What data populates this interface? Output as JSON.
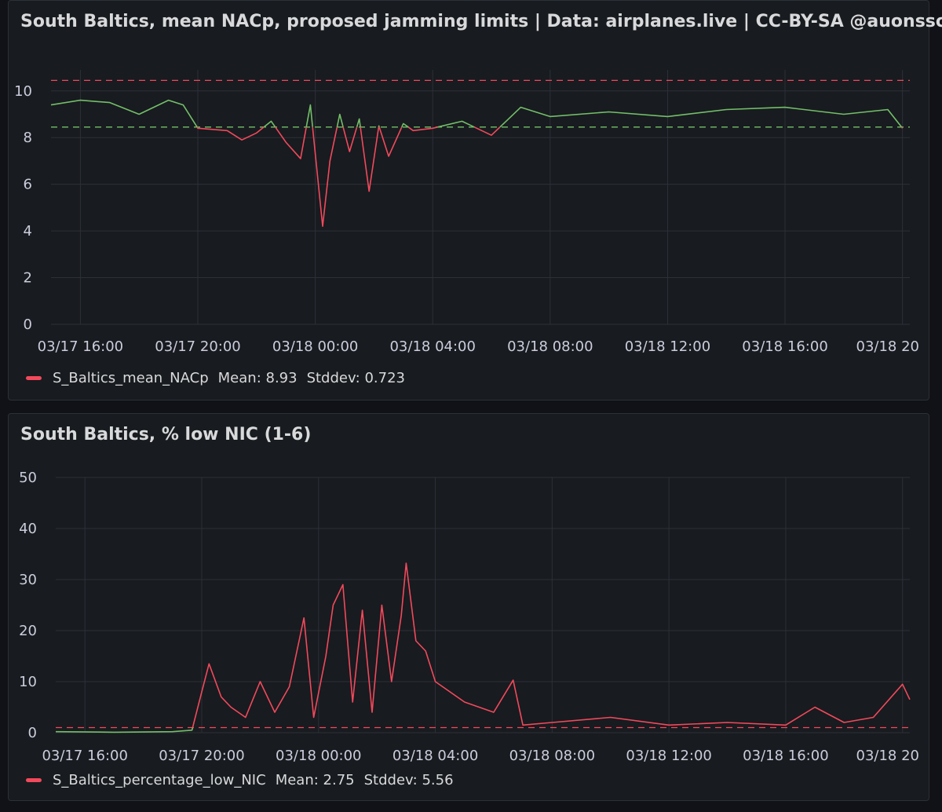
{
  "colors": {
    "ok": "#73bf69",
    "bad": "#f2495c",
    "grid": "#2c3038",
    "panel_bg": "#181b1f",
    "page_bg": "#111217"
  },
  "panels": [
    {
      "title": "South Baltics, mean NACp, proposed jamming limits | Data: airplanes.live | CC-BY-SA @auonsson",
      "legend": {
        "name": "S_Baltics_mean_NACp",
        "mean": "Mean: 8.93",
        "stddev": "Stddev: 0.723"
      }
    },
    {
      "title": "South Baltics, % low NIC (1-6)",
      "legend": {
        "name": "S_Baltics_percentage_low_NIC",
        "mean": "Mean: 2.75",
        "stddev": "Stddev: 5.56"
      }
    }
  ],
  "chart_data": [
    {
      "type": "line",
      "title": "South Baltics, mean NACp, proposed jamming limits | Data: airplanes.live | CC-BY-SA @auonsson",
      "xlabel": "",
      "ylabel": "",
      "xlim": [
        "03/17 15:00",
        "03/18 20:15"
      ],
      "ylim": [
        0,
        10.9
      ],
      "y_ticks": [
        0,
        2,
        4,
        6,
        8,
        10
      ],
      "x_ticks": [
        "03/17 16:00",
        "03/17 20:00",
        "03/18 00:00",
        "03/18 04:00",
        "03/18 08:00",
        "03/18 12:00",
        "03/18 16:00",
        "03/18 20"
      ],
      "grid": true,
      "legend_position": "bottom-left",
      "thresholds": [
        {
          "value": 10.45,
          "color": "#f2495c",
          "style": "dashed"
        },
        {
          "value": 8.45,
          "color": "#73bf69",
          "style": "dashed"
        }
      ],
      "color_rule": "line is green at or above 8.45 and red below",
      "series": [
        {
          "name": "S_Baltics_mean_NACp",
          "points": [
            [
              "03/17 15:00",
              9.4
            ],
            [
              "03/17 16:00",
              9.6
            ],
            [
              "03/17 17:00",
              9.5
            ],
            [
              "03/17 18:00",
              9.0
            ],
            [
              "03/17 19:00",
              9.6
            ],
            [
              "03/17 19:30",
              9.4
            ],
            [
              "03/17 20:00",
              8.4
            ],
            [
              "03/17 21:00",
              8.3
            ],
            [
              "03/17 21:30",
              7.9
            ],
            [
              "03/17 22:00",
              8.2
            ],
            [
              "03/17 22:30",
              8.7
            ],
            [
              "03/17 23:00",
              7.8
            ],
            [
              "03/17 23:30",
              7.1
            ],
            [
              "03/17 23:50",
              9.4
            ],
            [
              "03/18 00:15",
              4.2
            ],
            [
              "03/18 00:30",
              7.0
            ],
            [
              "03/18 00:50",
              9.0
            ],
            [
              "03/18 01:10",
              7.4
            ],
            [
              "03/18 01:30",
              8.8
            ],
            [
              "03/18 01:50",
              5.7
            ],
            [
              "03/18 02:10",
              8.5
            ],
            [
              "03/18 02:30",
              7.2
            ],
            [
              "03/18 03:00",
              8.6
            ],
            [
              "03/18 03:20",
              8.3
            ],
            [
              "03/18 04:00",
              8.4
            ],
            [
              "03/18 05:00",
              8.7
            ],
            [
              "03/18 06:00",
              8.1
            ],
            [
              "03/18 06:30",
              8.7
            ],
            [
              "03/18 07:00",
              9.3
            ],
            [
              "03/18 08:00",
              8.9
            ],
            [
              "03/18 10:00",
              9.1
            ],
            [
              "03/18 12:00",
              8.9
            ],
            [
              "03/18 14:00",
              9.2
            ],
            [
              "03/18 16:00",
              9.3
            ],
            [
              "03/18 18:00",
              9.0
            ],
            [
              "03/18 19:30",
              9.2
            ],
            [
              "03/18 20:00",
              8.4
            ]
          ]
        }
      ]
    },
    {
      "type": "line",
      "title": "South Baltics, % low NIC (1-6)",
      "xlabel": "",
      "ylabel": "",
      "xlim": [
        "03/17 15:00",
        "03/18 20:15"
      ],
      "ylim": [
        0,
        50
      ],
      "y_ticks": [
        0,
        10,
        20,
        30,
        40,
        50
      ],
      "x_ticks": [
        "03/17 16:00",
        "03/17 20:00",
        "03/18 00:00",
        "03/18 04:00",
        "03/18 08:00",
        "03/18 12:00",
        "03/18 16:00",
        "03/18 20"
      ],
      "grid": true,
      "legend_position": "bottom-left",
      "thresholds": [
        {
          "value": 1,
          "color": "#f2495c",
          "style": "dashed"
        }
      ],
      "color_rule": "line is green below 1 and red at or above 1",
      "series": [
        {
          "name": "S_Baltics_percentage_low_NIC",
          "points": [
            [
              "03/17 15:00",
              0.2
            ],
            [
              "03/17 17:00",
              0.1
            ],
            [
              "03/17 19:00",
              0.2
            ],
            [
              "03/17 19:40",
              0.5
            ],
            [
              "03/17 20:00",
              8.0
            ],
            [
              "03/17 20:15",
              13.5
            ],
            [
              "03/17 20:40",
              7.0
            ],
            [
              "03/17 21:00",
              5.0
            ],
            [
              "03/17 21:30",
              3.0
            ],
            [
              "03/17 22:00",
              10.0
            ],
            [
              "03/17 22:30",
              4.0
            ],
            [
              "03/17 23:00",
              9.0
            ],
            [
              "03/17 23:30",
              22.5
            ],
            [
              "03/17 23:50",
              3.0
            ],
            [
              "03/18 00:15",
              15.0
            ],
            [
              "03/18 00:30",
              25.0
            ],
            [
              "03/18 00:50",
              29.0
            ],
            [
              "03/18 01:10",
              6.0
            ],
            [
              "03/18 01:30",
              24.0
            ],
            [
              "03/18 01:50",
              4.0
            ],
            [
              "03/18 02:10",
              25.0
            ],
            [
              "03/18 02:30",
              10.0
            ],
            [
              "03/18 02:50",
              23.0
            ],
            [
              "03/18 03:00",
              33.2
            ],
            [
              "03/18 03:20",
              18.0
            ],
            [
              "03/18 03:40",
              16.0
            ],
            [
              "03/18 04:00",
              10.0
            ],
            [
              "03/18 05:00",
              6.0
            ],
            [
              "03/18 06:00",
              4.0
            ],
            [
              "03/18 06:40",
              10.3
            ],
            [
              "03/18 07:00",
              1.5
            ],
            [
              "03/18 08:00",
              2.0
            ],
            [
              "03/18 10:00",
              3.0
            ],
            [
              "03/18 12:00",
              1.5
            ],
            [
              "03/18 14:00",
              2.0
            ],
            [
              "03/18 16:00",
              1.5
            ],
            [
              "03/18 17:00",
              5.0
            ],
            [
              "03/18 18:00",
              2.0
            ],
            [
              "03/18 19:00",
              3.0
            ],
            [
              "03/18 20:00",
              9.5
            ],
            [
              "03/18 20:15",
              6.5
            ]
          ]
        }
      ]
    }
  ]
}
